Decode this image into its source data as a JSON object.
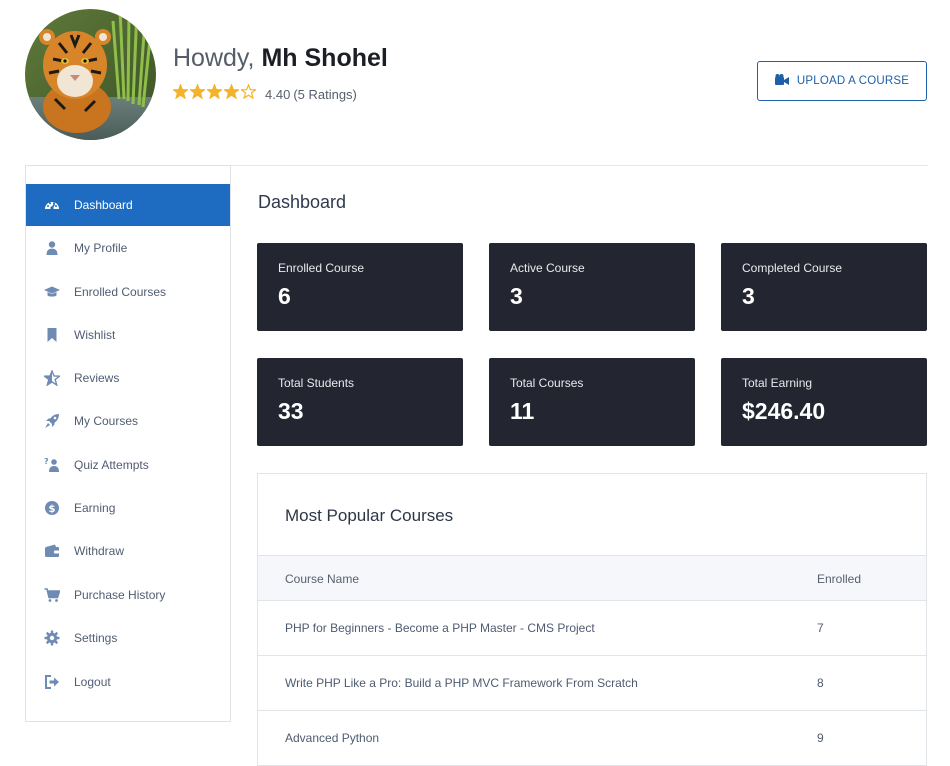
{
  "header": {
    "greeting": "Howdy, ",
    "user_name": "Mh Shohel",
    "rating_value": "4.40",
    "rating_count": "(5 Ratings)",
    "stars_filled": 4,
    "stars_total": 5,
    "upload_button": {
      "label": "UPLOAD A COURSE",
      "icon": "video-camera-icon"
    }
  },
  "sidebar": {
    "items": [
      {
        "label": "Dashboard",
        "icon": "dashboard-gauge-icon",
        "active": true
      },
      {
        "label": "My Profile",
        "icon": "user-icon",
        "active": false
      },
      {
        "label": "Enrolled Courses",
        "icon": "graduation-cap-icon",
        "active": false
      },
      {
        "label": "Wishlist",
        "icon": "bookmark-icon",
        "active": false
      },
      {
        "label": "Reviews",
        "icon": "star-half-icon",
        "active": false
      },
      {
        "label": "My Courses",
        "icon": "rocket-icon",
        "active": false
      },
      {
        "label": "Quiz Attempts",
        "icon": "question-person-icon",
        "active": false
      },
      {
        "label": "Earning",
        "icon": "dollar-circle-icon",
        "active": false
      },
      {
        "label": "Withdraw",
        "icon": "wallet-icon",
        "active": false
      },
      {
        "label": "Purchase History",
        "icon": "shopping-cart-icon",
        "active": false
      },
      {
        "label": "Settings",
        "icon": "gear-icon",
        "active": false
      },
      {
        "label": "Logout",
        "icon": "sign-out-icon",
        "active": false
      }
    ]
  },
  "main": {
    "title": "Dashboard",
    "stats": [
      {
        "label": "Enrolled Course",
        "value": "6"
      },
      {
        "label": "Active Course",
        "value": "3"
      },
      {
        "label": "Completed Course",
        "value": "3"
      },
      {
        "label": "Total Students",
        "value": "33"
      },
      {
        "label": "Total Courses",
        "value": "11"
      },
      {
        "label": "Total Earning",
        "value": "$246.40"
      }
    ],
    "popular": {
      "title": "Most Popular Courses",
      "columns": [
        "Course Name",
        "Enrolled"
      ],
      "rows": [
        {
          "name": "PHP for Beginners - Become a PHP Master - CMS Project",
          "enrolled": "7"
        },
        {
          "name": "Write PHP Like a Pro: Build a PHP MVC Framework From Scratch",
          "enrolled": "8"
        },
        {
          "name": "Advanced Python",
          "enrolled": "9"
        }
      ]
    }
  },
  "colors": {
    "accent": "#1e6cc2",
    "card_bg": "#232630",
    "star": "#f4b32c",
    "icon": "#6f8bb3"
  }
}
